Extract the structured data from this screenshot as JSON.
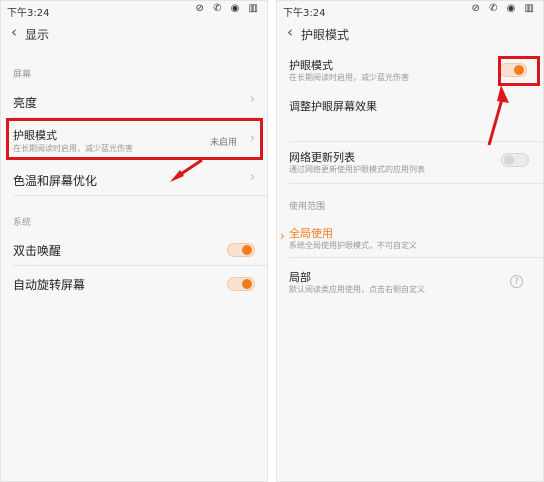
{
  "left": {
    "status_time": "下午3:24",
    "status_icons": "⊘ ✆ ◉ ▥",
    "header": {
      "back": "‹",
      "title": "显示"
    },
    "section_screen": "屏幕",
    "rows": [
      {
        "label": "亮度"
      },
      {
        "label": "护眼模式",
        "sub": "在长期阅读时启用，减少蓝光伤害",
        "value": "未启用"
      },
      {
        "label": "色温和屏幕优化"
      }
    ],
    "section_system": "系统",
    "sys_rows": [
      {
        "label": "双击唤醒",
        "toggle": "on"
      },
      {
        "label": "自动旋转屏幕",
        "toggle": "on"
      }
    ]
  },
  "right": {
    "status_time": "下午3:24",
    "status_icons": "⊘ ✆ ◉ ▥",
    "header": {
      "back": "‹",
      "title": "护眼模式"
    },
    "rows": [
      {
        "label": "护眼模式",
        "sub": "在长期阅读时启用，减少蓝光伤害",
        "toggle": "on"
      },
      {
        "label": "调整护眼屏幕效果"
      },
      {
        "label": "网络更新列表",
        "sub": "通过网络更新使用护眼模式的应用列表",
        "toggle": "off"
      }
    ],
    "section_scope": "使用范围",
    "scope_rows": [
      {
        "label": "全局使用",
        "sub": "系统全局使用护眼模式，不可自定义",
        "selected": true
      },
      {
        "label": "局部",
        "sub": "默认阅读类应用使用，点击右侧自定义"
      }
    ]
  },
  "colors": {
    "accent": "#f07c1e",
    "highlight_red": "#d9171c"
  }
}
